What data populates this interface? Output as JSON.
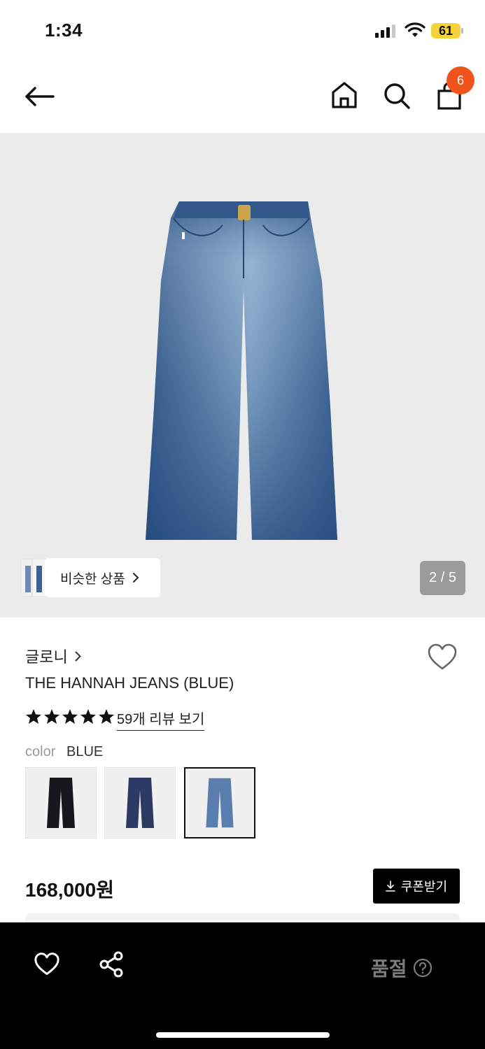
{
  "status_bar": {
    "time": "1:34",
    "battery": "61"
  },
  "header": {
    "cart_count": "6"
  },
  "hero": {
    "similar_label": "비슷한 상품",
    "pager": "2 / 5"
  },
  "product": {
    "brand": "글로니",
    "title": "THE HANNAH JEANS (BLUE)",
    "rating_stars": 5,
    "review_link": "59개 리뷰 보기",
    "color_label": "color",
    "color_value": "BLUE",
    "swatches": [
      {
        "color": "#16181c",
        "selected": false
      },
      {
        "color": "#2d3a63",
        "selected": false
      },
      {
        "color": "#5a7fae",
        "selected": true
      }
    ],
    "price": "168,000원",
    "coupon_label": "쿠폰받기"
  },
  "bottom_bar": {
    "soldout_label": "품절"
  },
  "colors": {
    "accent_badge": "#f0541c",
    "hero_bg": "#ebebeb",
    "bottom_bg": "#000000"
  }
}
